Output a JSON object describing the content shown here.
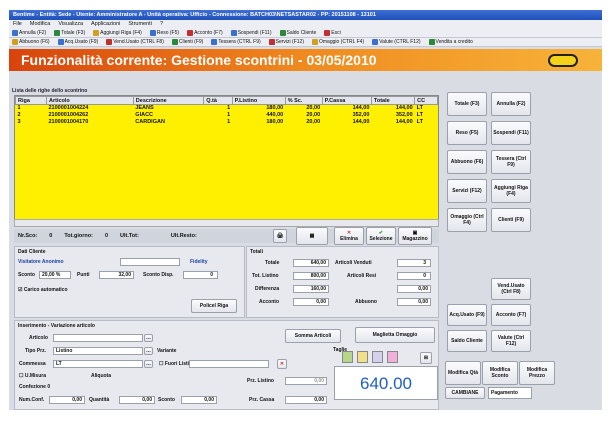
{
  "window": {
    "title": "Bentime - Entità: Sede - Utente: Amministratore A - Unità operativa: Ufficio - Connessione: BATCH03\\NETSASTAR02 - PP: 20151108 - 13101"
  },
  "menu": [
    "File",
    "Modifica",
    "Visualizza",
    "Applicazioni",
    "Strumenti",
    "?"
  ],
  "toolbar1": [
    {
      "label": "Annulla (F2)",
      "color": "#3a70d0"
    },
    {
      "label": "Totale (F3)",
      "color": "#2a8a3a"
    },
    {
      "label": "Aggiungi Riga (F4)",
      "color": "#d0a020"
    },
    {
      "label": "Reso (F5)",
      "color": "#3a70d0"
    },
    {
      "label": "Acconto (F7)",
      "color": "#c03030"
    },
    {
      "label": "Sospendi (F11)",
      "color": "#3a70d0"
    },
    {
      "label": "Saldo Cliente",
      "color": "#2a8a3a"
    },
    {
      "label": "Esci",
      "color": "#c03030"
    }
  ],
  "toolbar2": [
    {
      "label": "Abbuono (F6)",
      "color": "#d0a020"
    },
    {
      "label": "Acq.Usato (F9)",
      "color": "#3a70d0"
    },
    {
      "label": "Vend.Usato (CTRL F8)",
      "color": "#c03030"
    },
    {
      "label": "Clienti (F9)",
      "color": "#2a8a3a"
    },
    {
      "label": "Tessera (CTRL F9)",
      "color": "#3a70d0"
    },
    {
      "label": "Servizi (F12)",
      "color": "#c03030"
    },
    {
      "label": "Omaggio (CTRL F4)",
      "color": "#d0a020"
    },
    {
      "label": "Valute (CTRL F12)",
      "color": "#3a70d0"
    },
    {
      "label": "Vendita a credito",
      "color": "#2a8a3a"
    }
  ],
  "banner": "Funzionalità corrente: Gestione scontrini - 03/05/2010",
  "grid": {
    "section_label": "Lista delle righe dello scontrino",
    "columns": [
      "Riga",
      "Articolo",
      "Descrizione",
      "Q.tà",
      "P.Listino",
      "% Sc.",
      "P.Cassa",
      "Totale",
      "CC"
    ],
    "rows": [
      [
        "1",
        "2100001004224",
        "JEANS",
        "1",
        "180,00",
        "20,00",
        "144,00",
        "144,00",
        "LT"
      ],
      [
        "2",
        "2100001004262",
        "GIACC",
        "1",
        "440,00",
        "20,00",
        "352,00",
        "352,00",
        "LT"
      ],
      [
        "3",
        "2100001004170",
        "CARDIGAN",
        "1",
        "180,00",
        "20,00",
        "144,00",
        "144,00",
        "LT"
      ]
    ]
  },
  "bottombar": {
    "nr_sco": "Nr.Sco:",
    "nr_sco_val": "0",
    "tot_giorno": "Tot.giorno:",
    "tot_giorno_val": "0",
    "ult_tot": "Ult.Tot:",
    "ult_resto": "Ult.Resto:"
  },
  "grid_actions": [
    "Elimina",
    "Selezione",
    "Magazzino"
  ],
  "right_buttons": [
    [
      "Totale (F3)",
      "Annulla (F2)"
    ],
    [
      "Reso (F5)",
      "Sospendi (F11)"
    ],
    [
      "Abbuono (F6)",
      "Tessera (Ctrl F9)"
    ],
    [
      "Servizi (F12)",
      "Aggiungi Riga (F4)"
    ],
    [
      "Omaggio (Ctrl F4)",
      "Clienti (F9)"
    ]
  ],
  "right_buttons_low": [
    [
      "",
      "Vend.Usato (Ctrl F8)"
    ],
    [
      "Acq.Usato (F9)",
      "Acconto (F7)"
    ],
    [
      "Saldo Cliente",
      "Valute (Ctrl F12)"
    ]
  ],
  "modifica_buttons": [
    "Modifica Qtà",
    "Modifica Sconto",
    "Modifica Prezzo"
  ],
  "cassa": {
    "label": "CAMBIANE",
    "value": "Pagamento"
  },
  "cliente": {
    "section": "Dati Cliente",
    "name": "Visitatore Anonimo",
    "fidelity": "Fidelity",
    "sconto_label": "Sconto",
    "sconto_val": "20,00 %",
    "punti_label": "Punti",
    "punti_val": "32,00",
    "sconto_disp": "Sconto Disp.",
    "sconto_disp_val": "0",
    "carico_auto": "Carico automatico",
    "policel": "Policel Riga"
  },
  "totali": {
    "section": "Totali",
    "totale_label": "Totale",
    "totale_val": "640,00",
    "art_venduti_label": "Articoli Venduti",
    "art_venduti_val": "3",
    "tot_listino_label": "Tot. Listino",
    "tot_listino_val": "800,00",
    "art_resi_label": "Articoli Resi",
    "art_resi_val": "0",
    "differenza_label": "Differenza",
    "differenza_val": "160,00",
    "diff_right_val": "0,00",
    "acconto_label": "Acconto",
    "acconto_val": "0,00",
    "abbuono_label": "Abbuono",
    "abbuono_val": "0,00"
  },
  "inserimento": {
    "section": "Inserimento - Variazione articolo",
    "articolo": "Articolo",
    "tipo_prz": "Tipo Prz.",
    "tipo_prz_val": "Listino",
    "variante": "Variante",
    "commessa": "Commessa",
    "commessa_val": "LT",
    "fuori_listino": "Fuori Listino",
    "u_misura": "U.Misura",
    "aliquota": "Aliquota",
    "confezione": "Confezione",
    "confezione_val": "0",
    "num_conf": "Num.Conf.",
    "num_conf_val": "0,00",
    "quantita": "Quantità",
    "quantita_val": "0,00",
    "sconto": "Sconto",
    "sconto_val": "0,00",
    "prz_listino": "Prz. Listino",
    "prz_listino_val": "0,00",
    "prz_cassa": "Prz. Cassa",
    "prz_cassa_val": "0,00",
    "somma_articoli": "Somma Articoli",
    "maglietta": "Maglietta Omaggio",
    "taglie": "Taglie"
  },
  "total_display": "640.00",
  "swatches": [
    "#b7d68a",
    "#f3e08a",
    "#d6d0ef",
    "#f0b0d8"
  ]
}
